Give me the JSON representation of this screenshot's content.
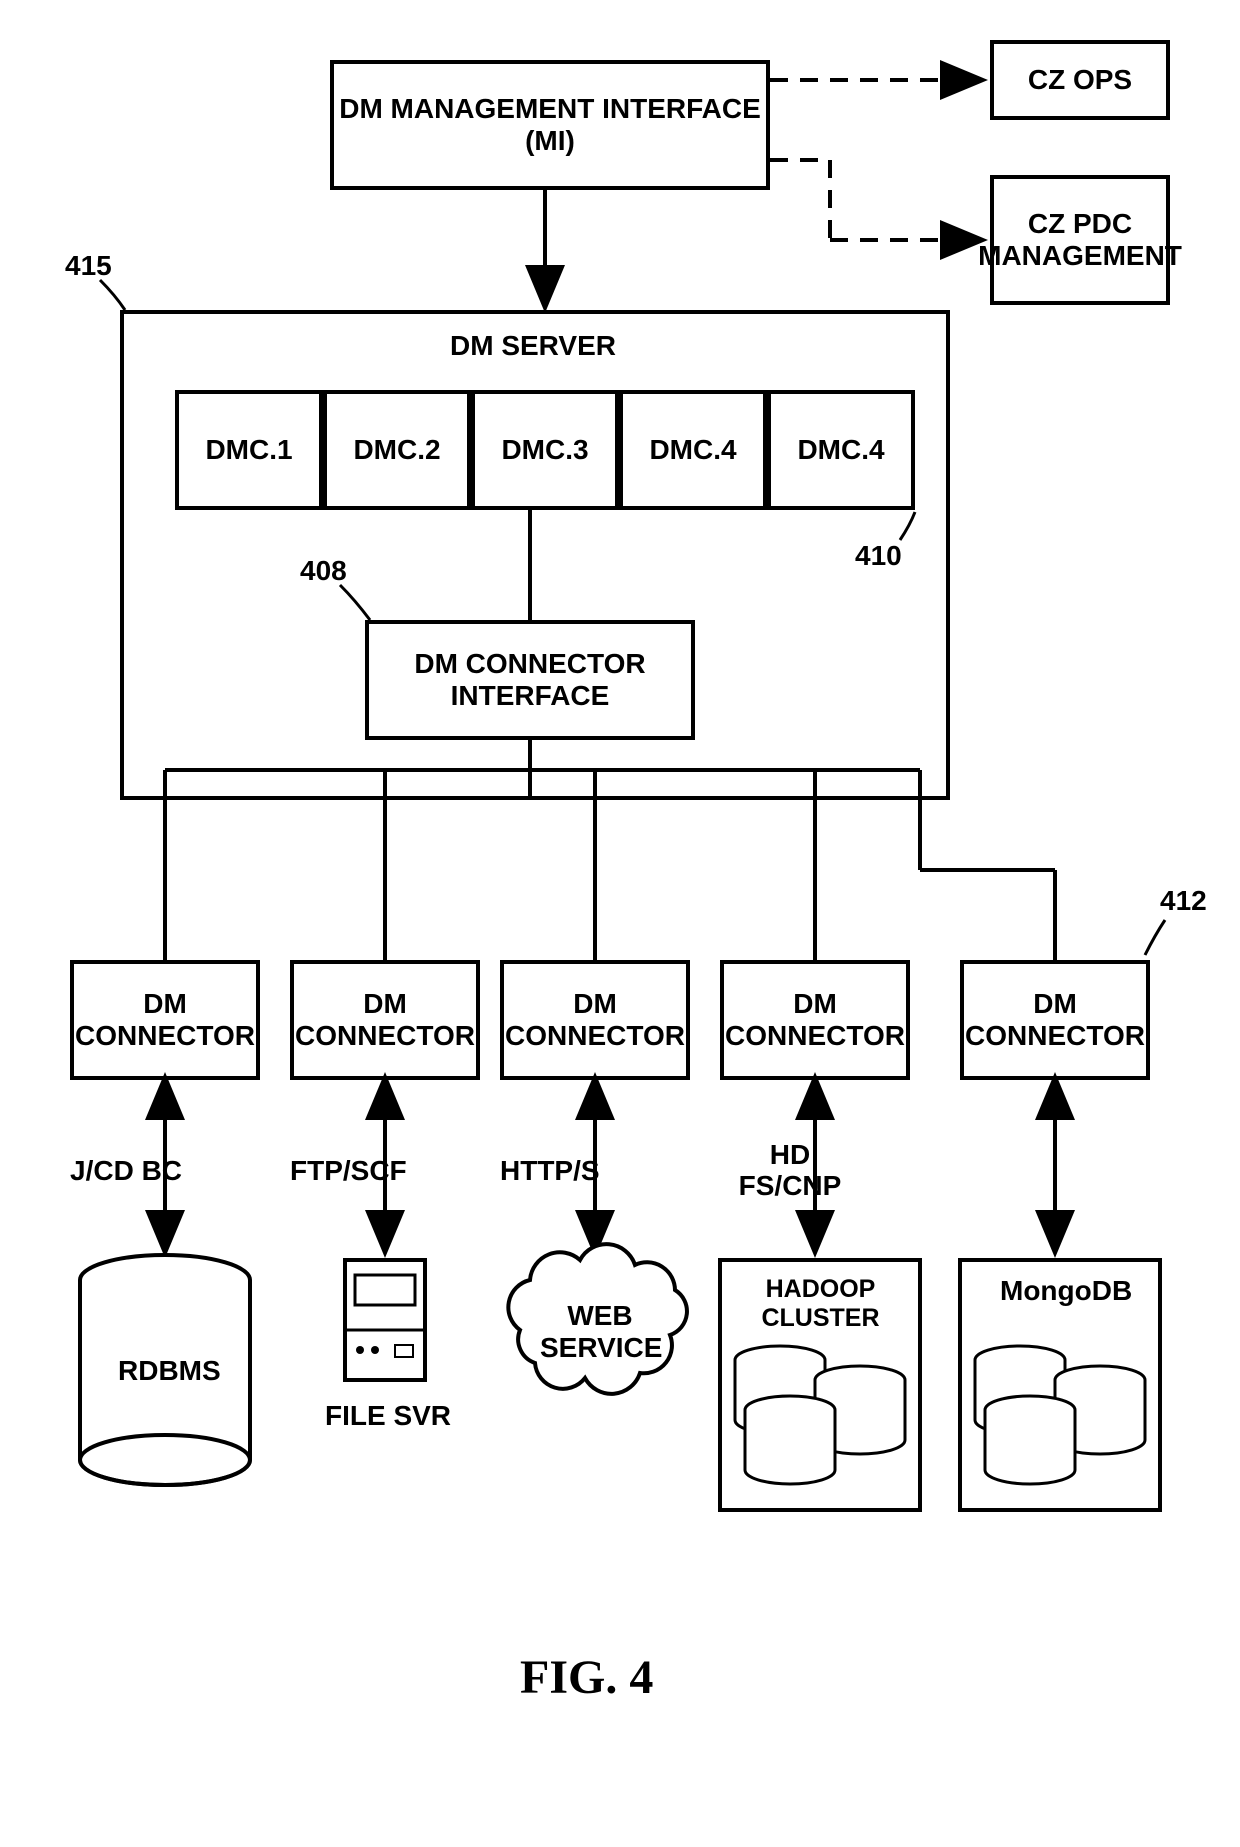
{
  "management_interface": "DM MANAGEMENT INTERFACE (MI)",
  "cz_ops": "CZ OPS",
  "cz_pdc": "CZ PDC MANAGEMENT",
  "dm_server": "DM SERVER",
  "dmc_slots": [
    "DMC.1",
    "DMC.2",
    "DMC.3",
    "DMC.4",
    "DMC.4"
  ],
  "connector_interface": "DM CONNECTOR INTERFACE",
  "connectors": [
    "DM CONNECTOR",
    "DM CONNECTOR",
    "DM CONNECTOR",
    "DM CONNECTOR",
    "DM CONNECTOR"
  ],
  "protocols": [
    "J/CD BC",
    "FTP/SCF",
    "HTTP/S",
    "HD FS/CNP",
    ""
  ],
  "targets": {
    "rdbms": "RDBMS",
    "file_svr": "FILE SVR",
    "web_service": "WEB SERVICE",
    "hadoop": "HADOOP CLUSTER",
    "mongodb": "MongoDB"
  },
  "refs": {
    "r415": "415",
    "r408": "408",
    "r410": "410",
    "r412": "412"
  },
  "figure": "FIG. 4"
}
